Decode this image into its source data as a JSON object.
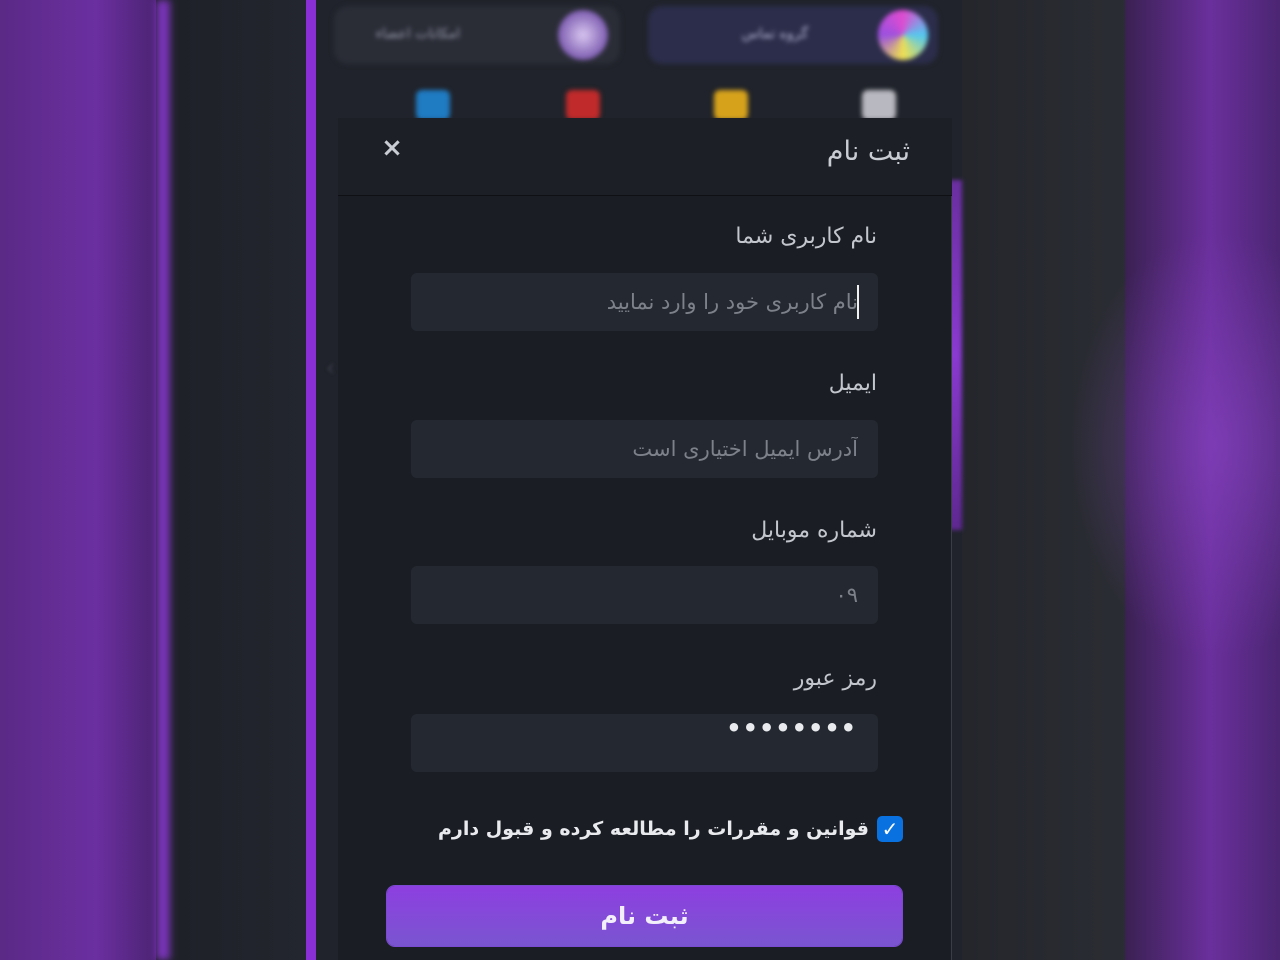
{
  "background": {
    "banner_left_text": "امکانات اعضاء",
    "banner_right_text": "گروه تماس"
  },
  "modal": {
    "title": "ثبت نام",
    "close_icon": "×",
    "fields": [
      {
        "label": "نام کاربری شما",
        "placeholder": "نام کاربری خود را وارد نمایید",
        "value": ""
      },
      {
        "label": "ایمیل",
        "placeholder": "آدرس ایمیل اختیاری است",
        "value": ""
      },
      {
        "label": "شماره موبایل",
        "placeholder": "۰۹",
        "value": ""
      },
      {
        "label": "رمز عبور",
        "placeholder": "",
        "value": "••••••••"
      }
    ],
    "terms_checked": true,
    "terms_text": "قوانین و مقررات را مطالعه کرده و قبول دارم",
    "checkmark": "✓",
    "submit_label": "ثبت نام"
  },
  "colors": {
    "accent_purple": "#8a2fd6",
    "checkbox_blue": "#0a72e0",
    "modal_bg": "#1a1d24",
    "input_bg": "#242830"
  }
}
